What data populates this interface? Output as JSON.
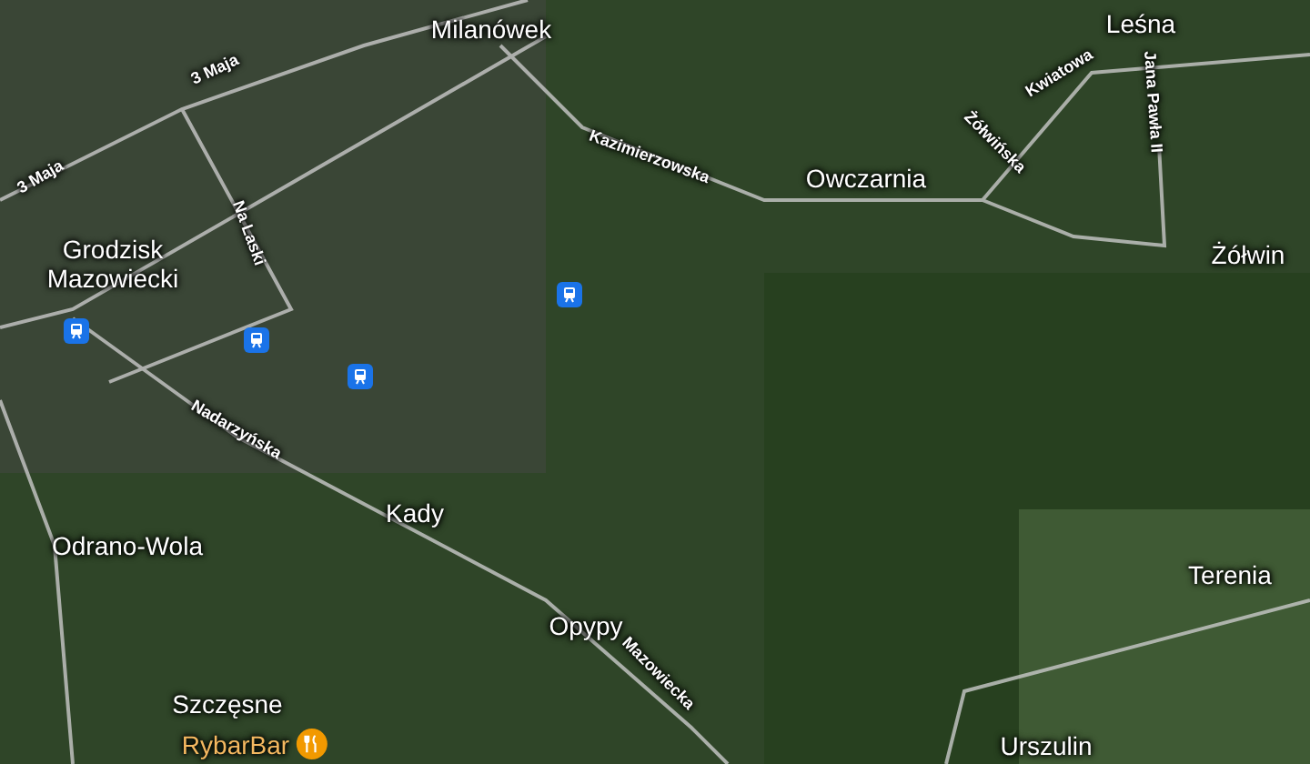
{
  "map": {
    "labels": [
      {
        "text": "Milanówek",
        "kind": "place"
      },
      {
        "text": "Leśna",
        "kind": "place"
      },
      {
        "text": "3 Maja",
        "kind": "street"
      },
      {
        "text": "Kwiatowa",
        "kind": "street"
      },
      {
        "text": "Jana Pawła II",
        "kind": "street"
      },
      {
        "text": "Żółwińska",
        "kind": "street"
      },
      {
        "text": "Kazimierzowska",
        "kind": "street"
      },
      {
        "text": "Owczarnia",
        "kind": "place"
      },
      {
        "text": "3 Maja",
        "kind": "street"
      },
      {
        "text": "Na Laski",
        "kind": "street"
      },
      {
        "text": "Grodzisk Mazowiecki",
        "kind": "place"
      },
      {
        "text": "Żółwin",
        "kind": "place"
      },
      {
        "text": "Nadarzyńska",
        "kind": "street"
      },
      {
        "text": "Kady",
        "kind": "place"
      },
      {
        "text": "Odrano-Wola",
        "kind": "place"
      },
      {
        "text": "Terenia",
        "kind": "place"
      },
      {
        "text": "Opypy",
        "kind": "place"
      },
      {
        "text": "Mazowiecka",
        "kind": "street"
      },
      {
        "text": "Szczęsne",
        "kind": "place"
      },
      {
        "text": "RybarBar",
        "kind": "restaurant"
      },
      {
        "text": "Urszulin",
        "kind": "place"
      }
    ]
  }
}
